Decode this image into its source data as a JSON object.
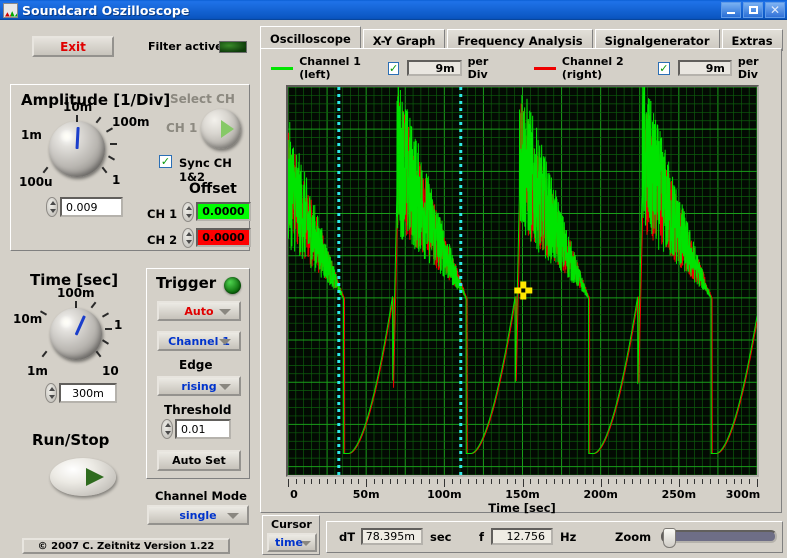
{
  "window": {
    "title": "Soundcard Oszilloscope",
    "minimize": "–",
    "maximize": "□",
    "close": "✕"
  },
  "toolbar": {
    "exit_label": "Exit",
    "filter_label": "Filter active",
    "filter_state": "on"
  },
  "amplitude": {
    "title": "Amplitude [1/Div]",
    "knob_labels": [
      "10m",
      "100m",
      "1m",
      "1",
      "100u"
    ],
    "value": "0.009",
    "select_ch_label": "Select CH",
    "ch_label": "CH 1",
    "sync_label": "Sync CH 1&2",
    "sync_checked": true,
    "offset_title": "Offset",
    "offset_ch1_label": "CH 1",
    "offset_ch1_value": "0.0000",
    "offset_ch1_color": "#00ff00",
    "offset_ch2_label": "CH 2",
    "offset_ch2_value": "0.0000",
    "offset_ch2_color": "#ff0000"
  },
  "time": {
    "title": "Time [sec]",
    "knob_labels": [
      "100m",
      "10m",
      "1",
      "1m",
      "10"
    ],
    "value": "300m",
    "run_stop_label": "Run/Stop"
  },
  "trigger": {
    "title": "Trigger",
    "led_color": "#0a7a0a",
    "mode": "Auto",
    "mode_color": "#e00000",
    "source": "Channel 1",
    "source_color": "#0033cc",
    "edge_label": "Edge",
    "edge": "rising",
    "edge_color": "#0033cc",
    "threshold_label": "Threshold",
    "threshold_value": "0.01",
    "auto_set_label": "Auto Set"
  },
  "channel_mode": {
    "label": "Channel Mode",
    "value": "single",
    "value_color": "#0033cc"
  },
  "copyright": "© 2007   C. Zeitnitz Version 1.22",
  "tabs": [
    {
      "label": "Oscilloscope",
      "active": true
    },
    {
      "label": "X-Y Graph",
      "active": false
    },
    {
      "label": "Frequency Analysis",
      "active": false
    },
    {
      "label": "Signalgenerator",
      "active": false
    },
    {
      "label": "Extras",
      "active": false
    }
  ],
  "legend": {
    "ch1_label": "Channel 1 (left)",
    "ch1_color": "#00e400",
    "ch1_checked": true,
    "ch1_perdiv": "9m",
    "ch2_label": "Channel 2 (right)",
    "ch2_color": "#ee0000",
    "ch2_checked": true,
    "ch2_perdiv": "9m",
    "per_div_label": "per Div"
  },
  "cursor": {
    "title": "Cursor",
    "mode": "time",
    "mode_color": "#0033cc",
    "dt_label": "dT",
    "dt_value": "78.395m",
    "dt_unit": "sec",
    "f_label": "f",
    "f_value": "12.756",
    "f_unit": "Hz",
    "zoom_label": "Zoom",
    "zoom_percent": 0
  },
  "chart_data": {
    "type": "line",
    "title": "",
    "xlabel": "Time [sec]",
    "ylabel": "",
    "xlim": [
      0,
      0.3
    ],
    "xtick_labels": [
      "0",
      "50m",
      "100m",
      "150m",
      "200m",
      "250m",
      "300m"
    ],
    "xtick_values": [
      0,
      0.05,
      0.1,
      0.15,
      0.2,
      0.25,
      0.3
    ],
    "ylim": [
      -0.045,
      0.045
    ],
    "grid": true,
    "grid_color": "#0f7a0f",
    "background": "#030a03",
    "legend_position": "top",
    "cursor_lines": [
      {
        "x": 0.0325,
        "color": "#2ee8e8",
        "style": "dotted"
      },
      {
        "x": 0.1105,
        "color": "#2ee8e8",
        "style": "dotted"
      }
    ],
    "cursor_marker": {
      "x": 0.1505,
      "y": -0.0022,
      "color": "#ffe800",
      "shape": "cross"
    },
    "series": [
      {
        "name": "Channel 1 (left)",
        "color": "#00e400",
        "description": "Noisy sawtooth: sharp rise then noisy decaying ramp, period ~78ms",
        "period": 0.0784,
        "waveform": "sawtooth-noisy",
        "amplitude": 0.033,
        "per_div": "9m"
      },
      {
        "name": "Channel 2 (right)",
        "color": "#ee0000",
        "description": "Overlapping trace, mostly hidden under Channel 1",
        "period": 0.0784,
        "waveform": "sawtooth-noisy",
        "amplitude": 0.031,
        "per_div": "9m"
      }
    ]
  }
}
